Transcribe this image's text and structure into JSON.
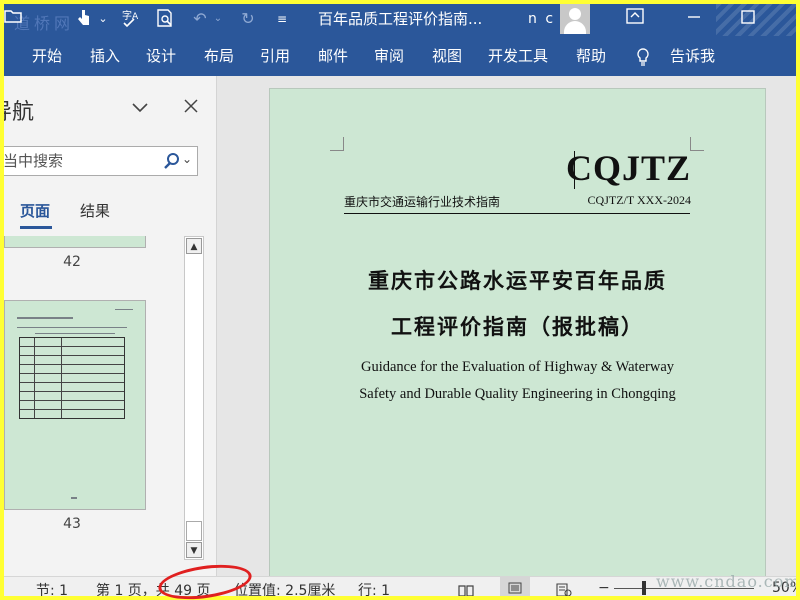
{
  "titlebar": {
    "doc_title": "百年品质工程评价指南...",
    "user_initials": "n c",
    "watermark": "道桥网"
  },
  "ribbon": {
    "tabs": [
      "开始",
      "插入",
      "设计",
      "布局",
      "引用",
      "邮件",
      "审阅",
      "视图",
      "开发工具",
      "帮助"
    ],
    "tell_me": "告诉我"
  },
  "nav": {
    "title_partial": "导航",
    "search_placeholder": "当中搜索",
    "tab_pages": "页面",
    "tab_results": "结果",
    "page_42": "42",
    "page_43": "43"
  },
  "document": {
    "brand": "CQJTZ",
    "header_left": "重庆市交通运输行业技术指南",
    "header_right": "CQJTZ/T XXX-2024",
    "title_line1": "重庆市公路水运平安百年品质",
    "title_line2": "工程评价指南（报批稿）",
    "en_line1": "Guidance for the Evaluation of Highway & Waterway",
    "en_line2": "Safety and Durable Quality Engineering in Chongqing"
  },
  "status": {
    "section": "节: 1",
    "page_info": "第 1 页，共 49 页",
    "position": "位置值: 2.5厘米",
    "line": "行: 1",
    "zoom": "50%",
    "watermark": "www.cndao.com"
  },
  "colors": {
    "ribbon_blue": "#2b579a",
    "page_green": "#cde7d3",
    "frame_yellow": "#ffff33",
    "highlight_red": "#e02020"
  }
}
